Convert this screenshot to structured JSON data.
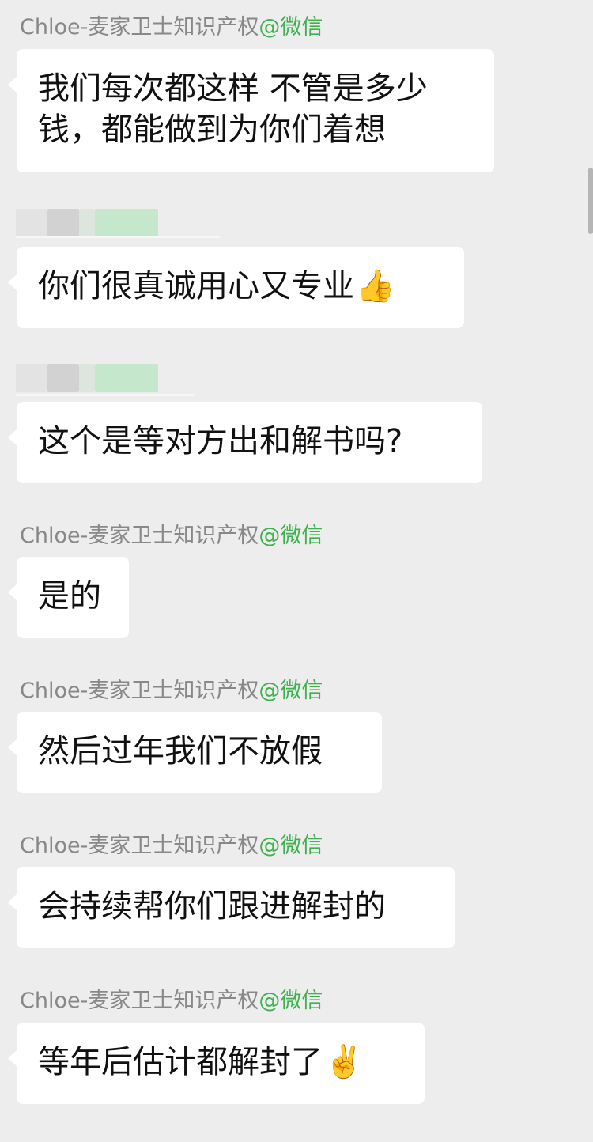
{
  "messages": [
    {
      "sender": "Chloe-麦家卫士知识产权",
      "source": "@微信",
      "text": "我们每次都这样 不管是多少钱，都能做到为你们着想",
      "emoji": ""
    },
    {
      "sender": "",
      "source": "",
      "text": "你们很真诚用心又专业",
      "emoji": "👍"
    },
    {
      "sender": "",
      "source": "",
      "text": "这个是等对方出和解书吗?",
      "emoji": ""
    },
    {
      "sender": "Chloe-麦家卫士知识产权",
      "source": "@微信",
      "text": "是的",
      "emoji": ""
    },
    {
      "sender": "Chloe-麦家卫士知识产权",
      "source": "@微信",
      "text": "然后过年我们不放假",
      "emoji": ""
    },
    {
      "sender": "Chloe-麦家卫士知识产权",
      "source": "@微信",
      "text": "会持续帮你们跟进解封的",
      "emoji": ""
    },
    {
      "sender": "Chloe-麦家卫士知识产权",
      "source": "@微信",
      "text": "等年后估计都解封了",
      "emoji": "✌️"
    }
  ],
  "colors": {
    "background": "#ededed",
    "bubble": "#ffffff",
    "sender_name": "#888888",
    "source_tag": "#3fb24f"
  }
}
